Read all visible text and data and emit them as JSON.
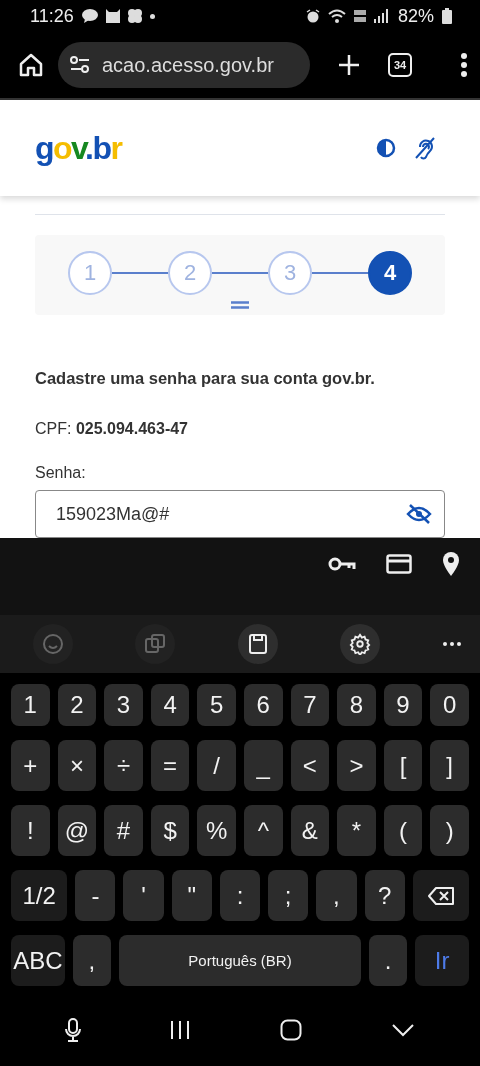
{
  "status_bar": {
    "time": "11:26",
    "battery": "82%"
  },
  "browser": {
    "url": "acao.acesso.gov.br",
    "tab_count": "34"
  },
  "header": {
    "logo": [
      {
        "text": "g",
        "color": "#1351b4"
      },
      {
        "text": "o",
        "color": "#f5bd00"
      },
      {
        "text": "v",
        "color": "#168821"
      },
      {
        "text": ".",
        "color": "#1351b4"
      },
      {
        "text": "b",
        "color": "#1351b4"
      },
      {
        "text": "r",
        "color": "#f5bd00"
      }
    ]
  },
  "steps": [
    {
      "label": "1",
      "selected": false
    },
    {
      "label": "2",
      "selected": false
    },
    {
      "label": "3",
      "selected": false
    },
    {
      "label": "4",
      "selected": true
    }
  ],
  "form": {
    "heading": "Cadastre uma senha para sua conta gov.br.",
    "cpf_label": "CPF:",
    "cpf_value": "025.094.463-47",
    "password_label": "Senha:",
    "password_value": "159023Ma@#"
  },
  "keyboard_toolbar": [
    {
      "kind": "emoji",
      "disabled": true
    },
    {
      "kind": "translate",
      "disabled": true
    },
    {
      "kind": "clipboard",
      "disabled": false
    },
    {
      "kind": "settings",
      "disabled": false
    },
    {
      "kind": "more"
    }
  ],
  "keyboard": [
    [
      {
        "kind": "key",
        "label": "1"
      },
      {
        "kind": "key",
        "label": "2"
      },
      {
        "kind": "key",
        "label": "3"
      },
      {
        "kind": "key",
        "label": "4"
      },
      {
        "kind": "key",
        "label": "5"
      },
      {
        "kind": "key",
        "label": "6"
      },
      {
        "kind": "key",
        "label": "7"
      },
      {
        "kind": "key",
        "label": "8"
      },
      {
        "kind": "key",
        "label": "9"
      },
      {
        "kind": "key",
        "label": "0"
      }
    ],
    [
      {
        "kind": "key",
        "label": "+"
      },
      {
        "kind": "key",
        "label": "×"
      },
      {
        "kind": "key",
        "label": "÷"
      },
      {
        "kind": "key",
        "label": "="
      },
      {
        "kind": "key",
        "label": "/"
      },
      {
        "kind": "key",
        "label": "_"
      },
      {
        "kind": "key",
        "label": "<"
      },
      {
        "kind": "key",
        "label": ">"
      },
      {
        "kind": "key",
        "label": "["
      },
      {
        "kind": "key",
        "label": "]"
      }
    ],
    [
      {
        "kind": "key",
        "label": "!"
      },
      {
        "kind": "key",
        "label": "@"
      },
      {
        "kind": "key",
        "label": "#"
      },
      {
        "kind": "key",
        "label": "$"
      },
      {
        "kind": "key",
        "label": "%"
      },
      {
        "kind": "key",
        "label": "^"
      },
      {
        "kind": "key",
        "label": "&"
      },
      {
        "kind": "key",
        "label": "*"
      },
      {
        "kind": "key",
        "label": "("
      },
      {
        "kind": "key",
        "label": ")"
      }
    ],
    [
      {
        "kind": "mode",
        "label": "1/2"
      },
      {
        "kind": "key",
        "label": "-"
      },
      {
        "kind": "key",
        "label": "'"
      },
      {
        "kind": "key",
        "label": "\""
      },
      {
        "kind": "key",
        "label": ":"
      },
      {
        "kind": "key",
        "label": ";"
      },
      {
        "kind": "key",
        "label": ","
      },
      {
        "kind": "key",
        "label": "?"
      },
      {
        "kind": "backspace"
      }
    ],
    [
      {
        "kind": "mode",
        "label": "ABC"
      },
      {
        "kind": "key",
        "label": ","
      },
      {
        "kind": "space",
        "label": "Português (BR)"
      },
      {
        "kind": "key",
        "label": "."
      },
      {
        "kind": "enter",
        "label": "Ir"
      }
    ]
  ]
}
